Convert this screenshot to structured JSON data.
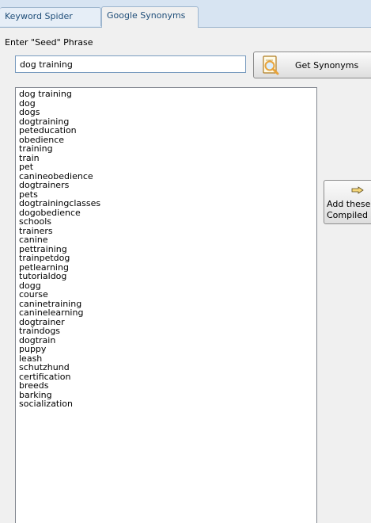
{
  "tabs": [
    {
      "label": "Keyword Spider",
      "active": false
    },
    {
      "label": "Google Synonyms",
      "active": true
    }
  ],
  "seed": {
    "label": "Enter \"Seed\" Phrase",
    "value": "dog training"
  },
  "get_button": {
    "label": "Get Synonyms",
    "icon": "magnifier-document-icon"
  },
  "synonyms": [
    "dog training",
    "dog",
    "dogs",
    "dogtraining",
    "peteducation",
    "obedience",
    "training",
    "train",
    "pet",
    "canineobedience",
    "dogtrainers",
    "pets",
    "dogtrainingclasses",
    "dogobedience",
    "schools",
    "trainers",
    "canine",
    "pettraining",
    "trainpetdog",
    "petlearning",
    "tutorialdog",
    "dogg",
    "course",
    "caninetraining",
    "caninelearning",
    "dogtrainer",
    "traindogs",
    "dogtrain",
    "puppy",
    "leash",
    "schutzhund",
    "certification",
    "breeds",
    "barking",
    "socialization"
  ],
  "add_button": {
    "line1": "Add these",
    "line2": "Compiled l",
    "icon": "pointing-hand-icon"
  },
  "colors": {
    "tab_text": "#1f4e79",
    "chrome": "#d7e4f2",
    "panel": "#f0f0f0",
    "icon_orange": "#e8a33a"
  }
}
